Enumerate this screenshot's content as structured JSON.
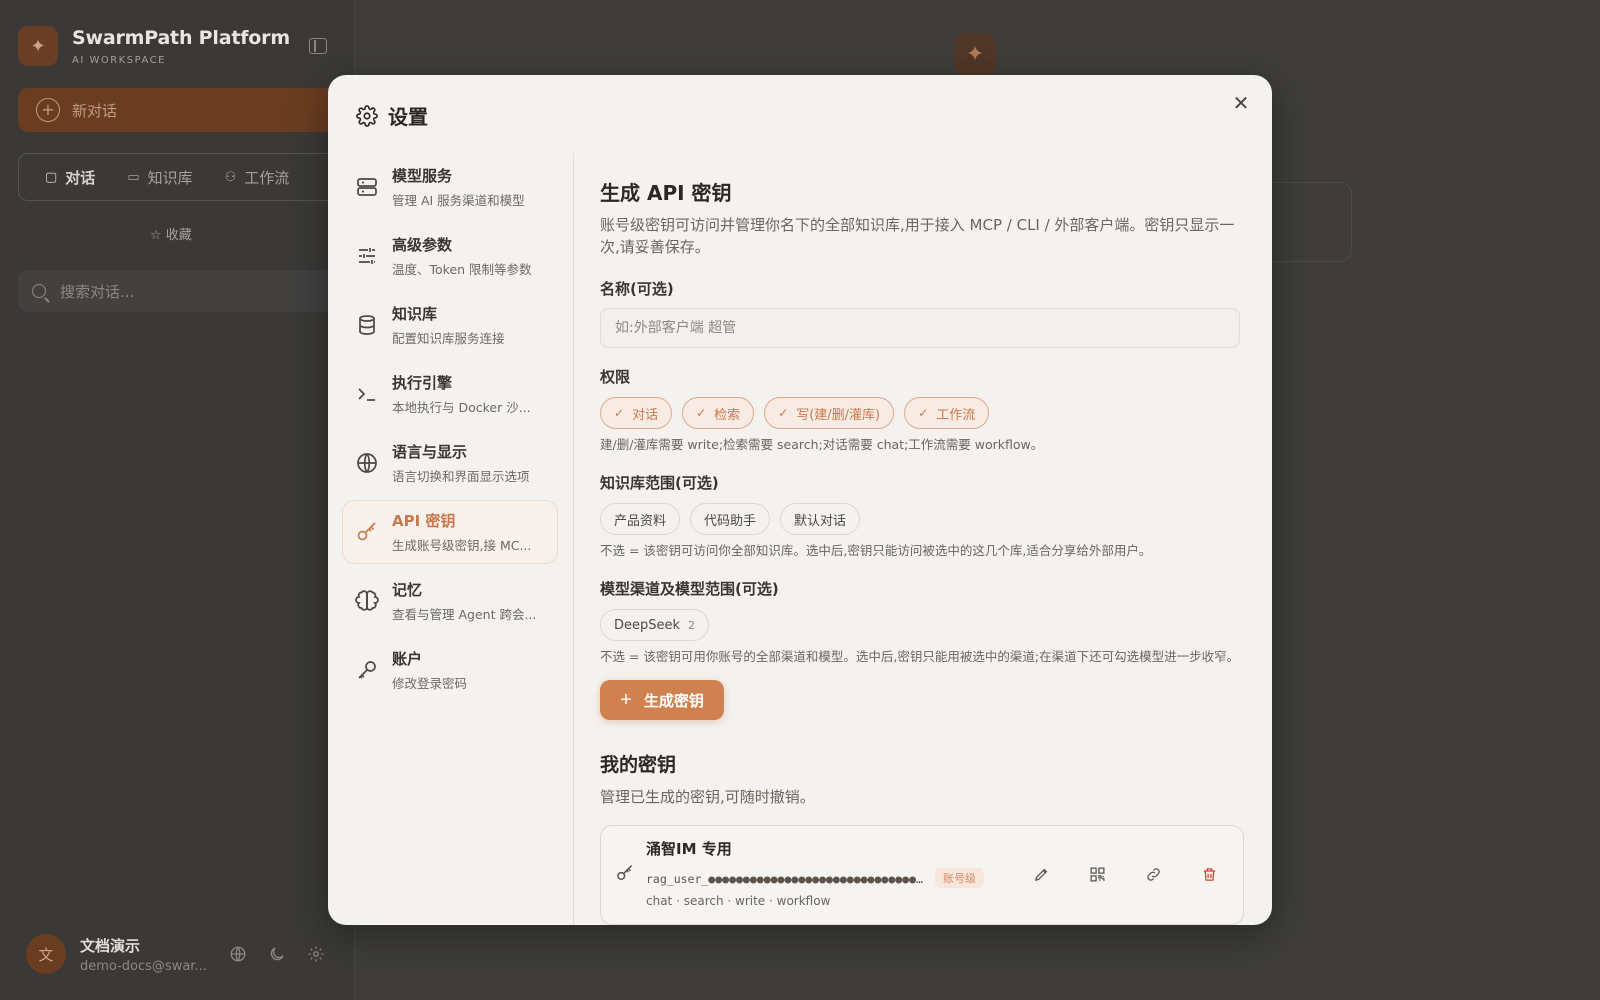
{
  "app": {
    "brand_title": "SwarmPath Platform",
    "brand_subtitle": "AI WORKSPACE",
    "new_chat_label": "新对话",
    "tabs": [
      {
        "label": "对话",
        "icon": "chat-icon"
      },
      {
        "label": "知识库",
        "icon": "book-icon"
      },
      {
        "label": "工作流",
        "icon": "workflow-icon"
      }
    ],
    "favorites_label": "收藏",
    "search_placeholder": "搜索对话...",
    "user": {
      "avatar_initial": "文",
      "name": "文档演示",
      "email": "demo-docs@swar..."
    }
  },
  "modal": {
    "title": "设置",
    "close_glyph": "✕",
    "nav": [
      {
        "label": "模型服务",
        "desc": "管理 AI 服务渠道和模型",
        "icon": "server-icon",
        "active": false
      },
      {
        "label": "高级参数",
        "desc": "温度、Token 限制等参数",
        "icon": "sliders-icon",
        "active": false
      },
      {
        "label": "知识库",
        "desc": "配置知识库服务连接",
        "icon": "database-icon",
        "active": false
      },
      {
        "label": "执行引擎",
        "desc": "本地执行与 Docker 沙...",
        "icon": "terminal-icon",
        "active": false
      },
      {
        "label": "语言与显示",
        "desc": "语言切换和界面显示选项",
        "icon": "globe-icon",
        "active": false
      },
      {
        "label": "API 密钥",
        "desc": "生成账号级密钥,接 MC...",
        "icon": "key-icon",
        "active": true
      },
      {
        "label": "记忆",
        "desc": "查看与管理 Agent 跨会...",
        "icon": "brain-icon",
        "active": false
      },
      {
        "label": "账户",
        "desc": "修改登录密码",
        "icon": "wrench-key-icon",
        "active": false
      }
    ],
    "api": {
      "title": "生成 API 密钥",
      "description": "账号级密钥可访问并管理你名下的全部知识库,用于接入 MCP / CLI / 外部客户端。密钥只显示一次,请妥善保存。",
      "name_label": "名称(可选)",
      "name_placeholder": "如:外部客户端 超管",
      "permissions_label": "权限",
      "permissions": [
        "对话",
        "检索",
        "写(建/删/灌库)",
        "工作流"
      ],
      "permissions_hint": "建/删/灌库需要 write;检索需要 search;对话需要 chat;工作流需要 workflow。",
      "kb_scope_label": "知识库范围(可选)",
      "kb_scopes": [
        "产品资料",
        "代码助手",
        "默认对话"
      ],
      "kb_scope_hint": "不选 = 该密钥可访问你全部知识库。选中后,密钥只能访问被选中的这几个库,适合分享给外部用户。",
      "model_scope_label": "模型渠道及模型范围(可选)",
      "model_channels": [
        {
          "label": "DeepSeek",
          "count": "2"
        }
      ],
      "model_scope_hint": "不选 = 该密钥可用你账号的全部渠道和模型。选中后,密钥只能用被选中的渠道;在渠道下还可勾选模型进一步收窄。",
      "generate_button": "生成密钥",
      "my_keys_title": "我的密钥",
      "my_keys_desc": "管理已生成的密钥,可随时撤销。",
      "keys": [
        {
          "name": "涌智IM 专用",
          "token": "rag_user_●●●●●●●●●●●●●●●●●●●●●●●●●●●●●●●●●●●●●●●●",
          "badge": "账号级",
          "scopes": "chat · search · write · workflow"
        }
      ]
    }
  },
  "colors": {
    "accent": "#cf8150",
    "accent_text": "#c87a4e",
    "danger": "#d43f33"
  }
}
